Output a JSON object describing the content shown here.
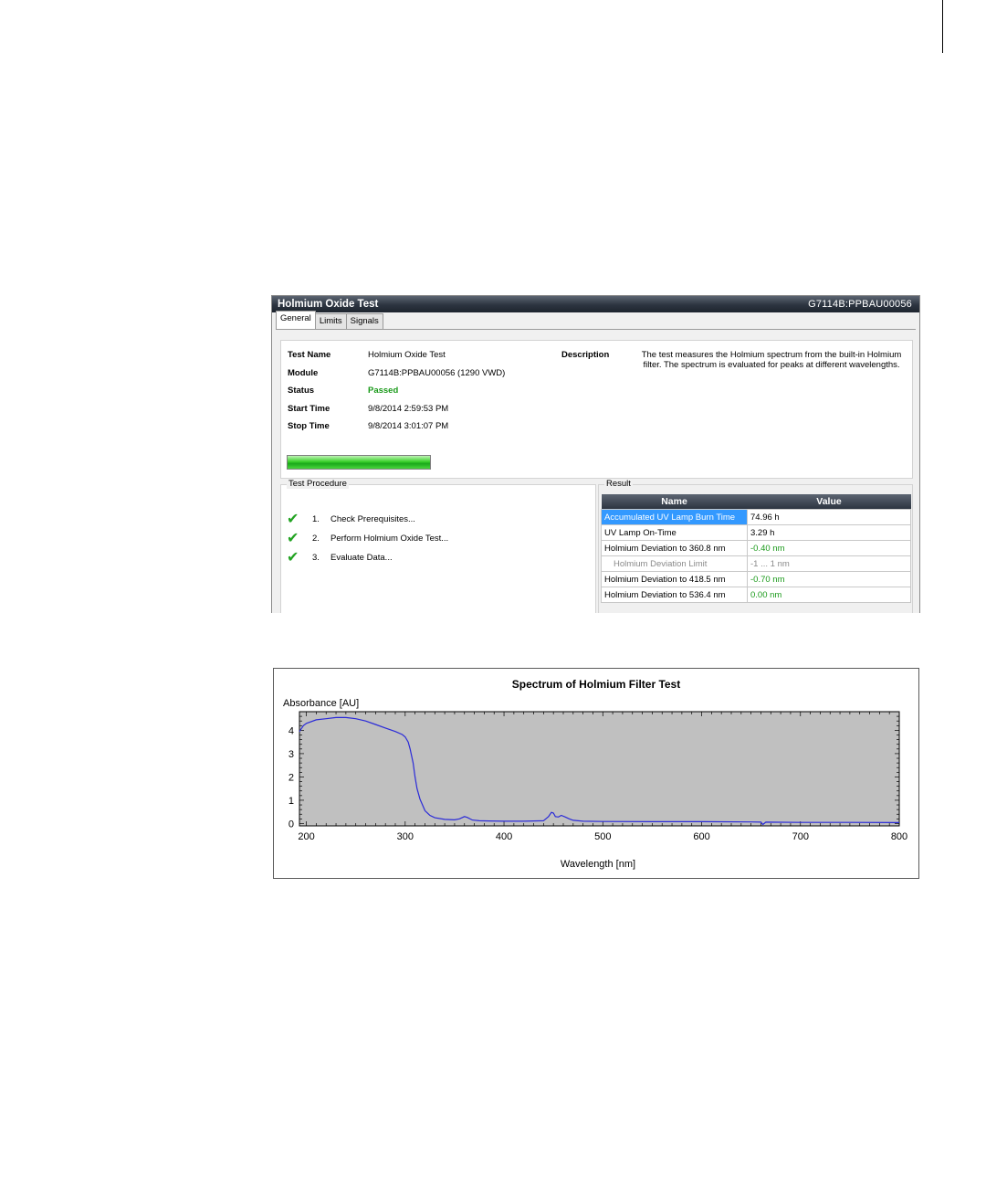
{
  "window": {
    "title": "Holmium Oxide Test",
    "module_id": "G7114B:PPBAU00056"
  },
  "tabs": [
    {
      "label": "General",
      "active": true
    },
    {
      "label": "Limits",
      "active": false
    },
    {
      "label": "Signals",
      "active": false
    }
  ],
  "general": {
    "test_name_label": "Test  Name",
    "test_name": "Holmium Oxide Test",
    "module_label": "Module",
    "module": "G7114B:PPBAU00056 (1290 VWD)",
    "status_label": "Status",
    "status": "Passed",
    "start_time_label": "Start  Time",
    "start_time": "9/8/2014 2:59:53 PM",
    "stop_time_label": "Stop  Time",
    "stop_time": "9/8/2014 3:01:07 PM",
    "description_label": "Description",
    "description": "The test measures the Holmium spectrum from the built-in Holmium filter. The spectrum is evaluated for peaks at different wavelengths.",
    "progress": 1.0,
    "status_color": "#1a9a1a"
  },
  "procedure": {
    "title": "Test Procedure",
    "steps": [
      {
        "num": "1.",
        "label": "Check Prerequisites...",
        "icon": "checkmark-icon"
      },
      {
        "num": "2.",
        "label": "Perform Holmium Oxide Test...",
        "icon": "checkmark-icon"
      },
      {
        "num": "3.",
        "label": "Evaluate Data...",
        "icon": "checkmark-icon"
      }
    ]
  },
  "result": {
    "title": "Result",
    "col_name": "Name",
    "col_value": "Value",
    "rows": [
      {
        "name": "Accumulated UV Lamp Burn Time",
        "value": "74.96 h"
      },
      {
        "name": "UV Lamp On-Time",
        "value": "3.29 h"
      },
      {
        "name": "Holmium Deviation to 360.8 nm",
        "value": "-0.40 nm"
      },
      {
        "name": "Holmium Deviation Limit",
        "value": "-1 ... 1 nm"
      },
      {
        "name": "Holmium Deviation to 418.5 nm",
        "value": "-0.70 nm"
      },
      {
        "name": "Holmium Deviation to 536.4 nm",
        "value": "0.00 nm"
      }
    ]
  },
  "chart_data": {
    "type": "line",
    "title": "Spectrum of Holmium Filter Test",
    "ylabel": "Absorbance [AU]",
    "xlabel": "Wavelength [nm]",
    "xlim": [
      193,
      800
    ],
    "ylim": [
      -0.1,
      4.8
    ],
    "xticks": [
      200,
      300,
      400,
      500,
      600,
      700,
      800
    ],
    "yticks": [
      0,
      1,
      2,
      3,
      4
    ],
    "plot_background": "#c0c0c0",
    "line_color": "#2a2ad8",
    "grid": false,
    "series": [
      {
        "x": [
          193,
          197,
          200,
          210,
          220,
          230,
          240,
          250,
          260,
          270,
          280,
          290,
          297,
          300,
          303,
          305,
          308,
          310,
          312,
          315,
          318,
          320,
          325,
          330,
          340,
          350,
          355,
          360,
          363,
          368,
          375,
          385,
          400,
          420,
          440,
          445,
          448,
          450,
          452,
          455,
          458,
          462,
          466,
          470,
          480,
          500,
          550,
          600,
          650,
          660,
          662,
          665,
          700,
          750,
          800
        ],
        "y": [
          3.95,
          4.2,
          4.3,
          4.45,
          4.5,
          4.55,
          4.55,
          4.5,
          4.4,
          4.25,
          4.1,
          3.95,
          3.82,
          3.72,
          3.5,
          3.2,
          2.6,
          2.0,
          1.5,
          1.05,
          0.75,
          0.55,
          0.35,
          0.25,
          0.18,
          0.16,
          0.2,
          0.3,
          0.26,
          0.15,
          0.12,
          0.11,
          0.1,
          0.1,
          0.12,
          0.3,
          0.48,
          0.45,
          0.3,
          0.28,
          0.35,
          0.28,
          0.2,
          0.14,
          0.1,
          0.09,
          0.08,
          0.08,
          0.07,
          0.06,
          -0.04,
          0.06,
          0.05,
          0.05,
          0.04
        ]
      }
    ]
  }
}
